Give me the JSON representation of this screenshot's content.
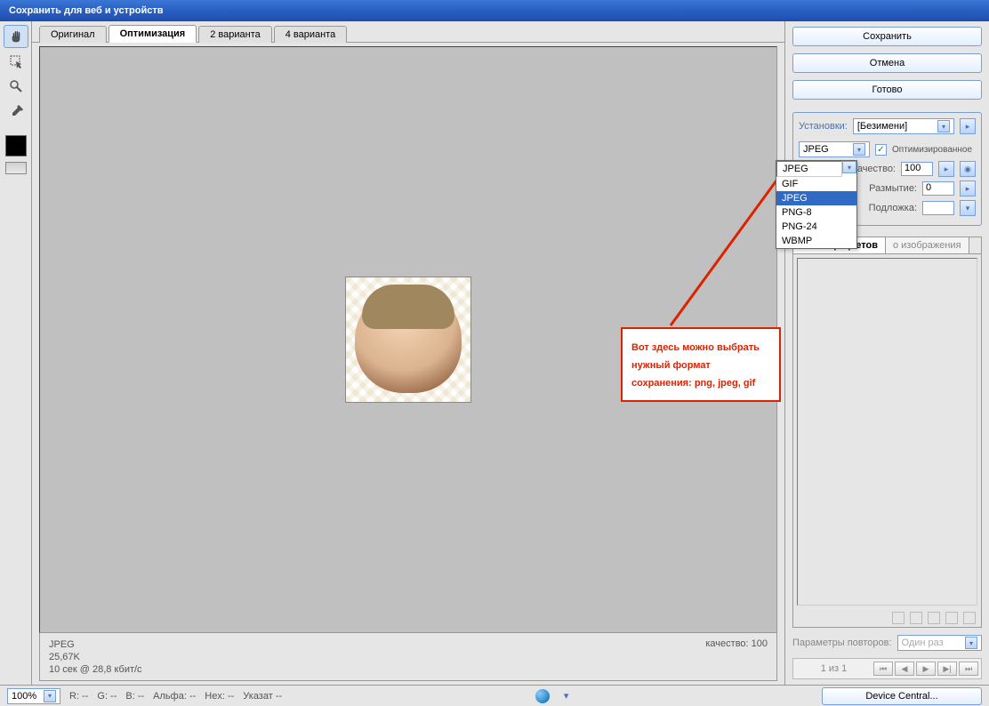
{
  "window": {
    "title": "Сохранить для веб и устройств"
  },
  "tabs": [
    {
      "label": "Оригинал"
    },
    {
      "label": "Оптимизация"
    },
    {
      "label": "2 варианта"
    },
    {
      "label": "4 варианта"
    }
  ],
  "active_tab": 1,
  "info": {
    "format": "JPEG",
    "size": "25,67K",
    "time": "10 сек @ 28,8 кбит/с",
    "quality": "качество: 100"
  },
  "buttons": {
    "save": "Сохранить",
    "cancel": "Отмена",
    "done": "Готово",
    "device_central": "Device Central..."
  },
  "settings": {
    "legend": "Установки:",
    "preset": "[Безимени]",
    "format_selected": "JPEG",
    "format_options": [
      "GIF",
      "JPEG",
      "PNG-8",
      "PNG-24",
      "WBMP"
    ],
    "optimized_label": "Оптимизированное",
    "optimized_checked": true,
    "quality_label": "Качество:",
    "quality_value": "100",
    "blur_label": "Размытие:",
    "blur_value": "0",
    "matte_label": "Подложка:"
  },
  "color_table": {
    "tab1": "Таблица цветов",
    "tab2": "о изображения"
  },
  "repeat": {
    "label": "Параметры повторов:",
    "value": "Один раз"
  },
  "playback": {
    "counter": "1 из 1"
  },
  "annotation": {
    "text": "Вот здесь можно выбрать нужный формат сохранения: png, jpeg, gif"
  },
  "status": {
    "zoom": "100%",
    "r": "R:    --",
    "g": "G:    --",
    "b": "B:    --",
    "alpha": "Альфа:    --",
    "hex": "Hex:    --",
    "index": "Указат    --"
  }
}
